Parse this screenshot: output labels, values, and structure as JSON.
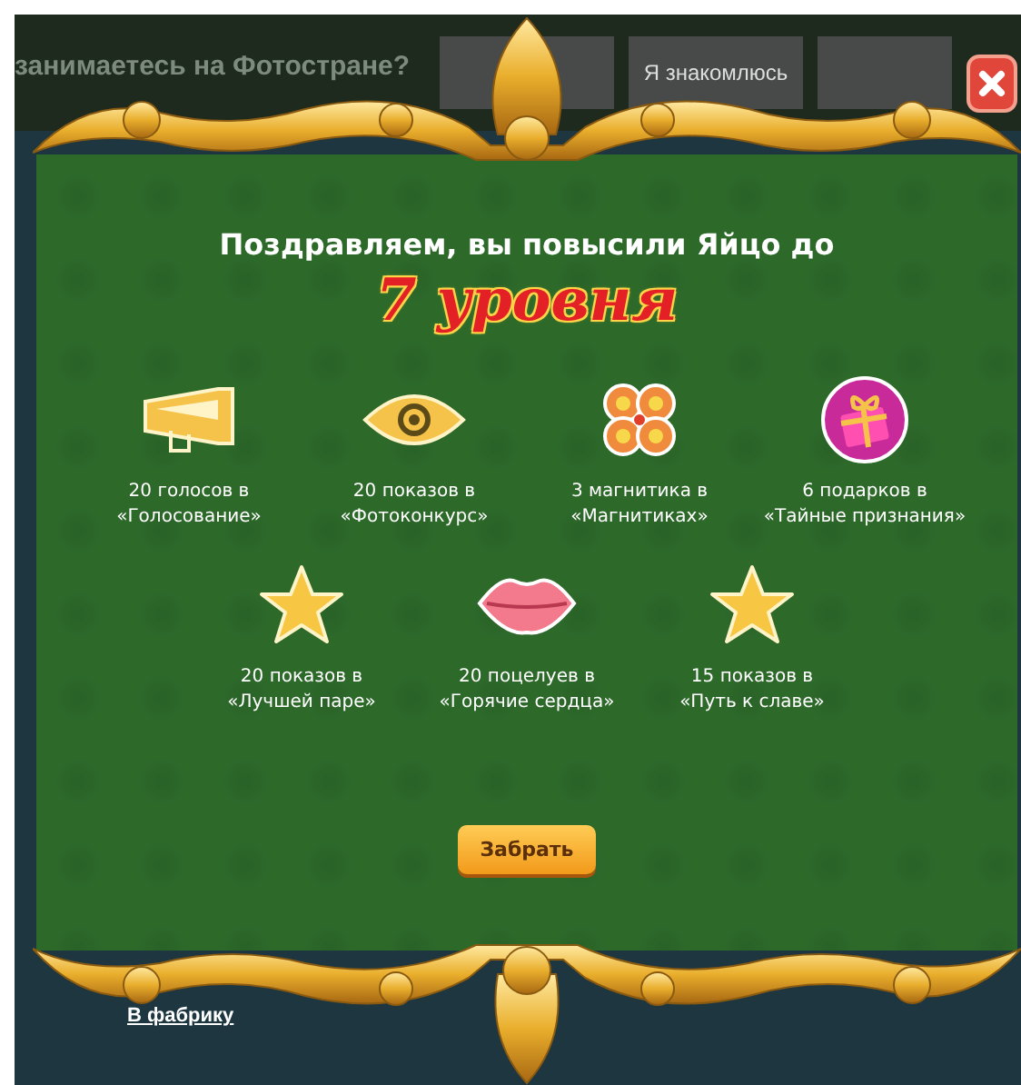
{
  "background_page": {
    "header_title": "занимаетесь на Фотостране?",
    "header_button": "Я знакомлюсь",
    "friends_link": "В фабрику"
  },
  "dialog": {
    "title": "Поздравляем, вы повысили Яйцо до",
    "level_text": "7 уровня",
    "rewards": [
      {
        "kind": "megaphone",
        "text": "20 голосов в\n«Голосование»"
      },
      {
        "kind": "eye",
        "text": "20 показов в\n«Фотоконкурс»"
      },
      {
        "kind": "clover",
        "text": "3 магнитика в\n«Магнитиках»"
      },
      {
        "kind": "gift",
        "text": "6 подарков в\n«Тайные признания»"
      },
      {
        "kind": "star",
        "text": "20 показов в\n«Лучшей паре»"
      },
      {
        "kind": "lips",
        "text": "20 поцелуев в\n«Горячие сердца»"
      },
      {
        "kind": "star",
        "text": "15 показов в\n«Путь к славе»"
      }
    ],
    "button": "Забрать"
  }
}
